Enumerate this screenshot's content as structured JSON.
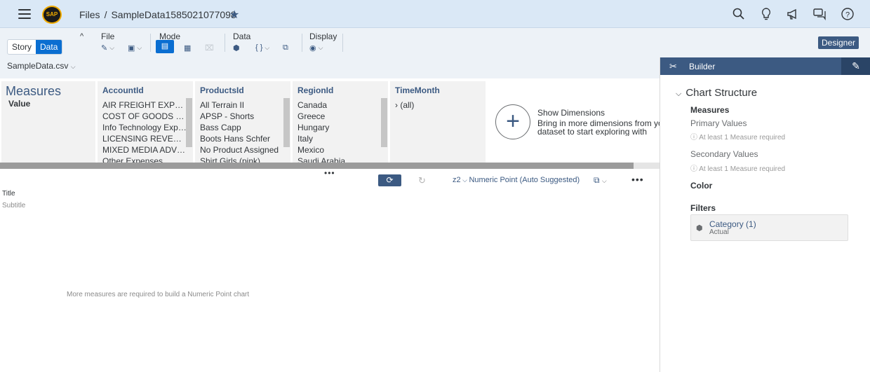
{
  "shell": {
    "logo_text": "SAP",
    "breadcrumb_root": "Files",
    "breadcrumb_sep": "/",
    "document_name": "SampleData1585021077098",
    "icons": [
      "menu-icon",
      "search-icon",
      "lightbulb-icon",
      "megaphone-icon",
      "chat-icon",
      "help-icon"
    ]
  },
  "toolbar": {
    "story_label": "Story",
    "data_label": "Data",
    "groups": {
      "file": "File",
      "mode": "Mode",
      "data": "Data",
      "display": "Display"
    },
    "data_braces": "{ }",
    "designer_label": "Designer"
  },
  "dataset": {
    "name": "SampleData.csv"
  },
  "data_panel": {
    "measures": {
      "title": "Measures",
      "value": "Value"
    },
    "columns": [
      {
        "header": "AccountId",
        "items": [
          "AIR FREIGHT EXPEN...",
          "COST OF GOODS S...",
          "Info Technology Expe...",
          "LICENSING REVENUE",
          "MIXED MEDIA ADVE...",
          "Other Expenses"
        ]
      },
      {
        "header": "ProductsId",
        "items": [
          "All Terrain II",
          "APSP - Shorts",
          "Bass Capp",
          "Boots Hans Schfer",
          "No Product Assigned",
          "Shirt Girls (pink)"
        ]
      },
      {
        "header": "RegionId",
        "items": [
          "Canada",
          "Greece",
          "Hungary",
          "Italy",
          "Mexico",
          "Saudi Arabia"
        ]
      },
      {
        "header": "TimeMonth",
        "items": [
          "(all)"
        ]
      }
    ],
    "show_dimensions": {
      "title": "Show Dimensions",
      "line1": "Bring in more dimensions from you",
      "line2": "dataset to start exploring with"
    },
    "grip": "•••"
  },
  "chart": {
    "type_prefix": "z2",
    "type_label": "Numeric Point (Auto Suggested)",
    "title": "Title",
    "subtitle": "Subtitle",
    "message": "More measures are required to build a Numeric Point chart",
    "more": "•••"
  },
  "builder": {
    "title": "Builder",
    "structure_title": "Chart Structure",
    "measures_heading": "Measures",
    "primary_values": "Primary Values",
    "primary_hint": "At least 1 Measure required",
    "secondary_values": "Secondary Values",
    "secondary_hint": "At least 1 Measure required",
    "color_heading": "Color",
    "filters_heading": "Filters",
    "filter": {
      "name": "Category (1)",
      "value": "Actual"
    }
  }
}
